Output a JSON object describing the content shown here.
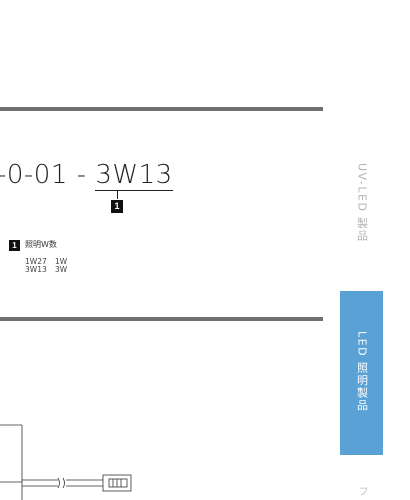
{
  "part_number": {
    "prefix": "-0-01 - ",
    "code": "3W13",
    "badge": "1"
  },
  "legend": {
    "badge": "1",
    "title": "照明W数",
    "rows": [
      {
        "code": "1W27",
        "value": "1W"
      },
      {
        "code": "3W13",
        "value": "3W"
      }
    ]
  },
  "side_tabs": {
    "uv": "UV-LED 製品",
    "led": "LED 照明製品",
    "next": "フ"
  },
  "colors": {
    "rule": "#6f6f6f",
    "tab_active": "#5aa2d6",
    "tab_inactive_text": "#b3b3b3"
  }
}
